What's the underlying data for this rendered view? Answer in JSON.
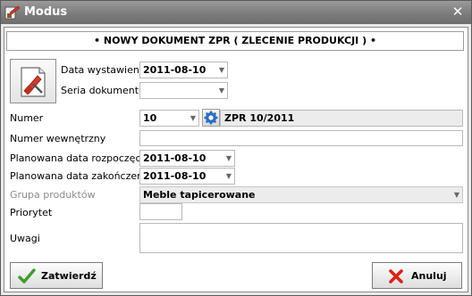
{
  "window": {
    "title": "Modus",
    "close_glyph": "✕"
  },
  "header": {
    "text": "• NOWY DOKUMENT ZPR ( ZLECENIE PRODUKCJI ) •"
  },
  "fields": {
    "data_wystawienia": {
      "label": "Data wystawienia",
      "value": "2011-08-10"
    },
    "seria_dokumentu": {
      "label": "Seria dokumentu",
      "value": ""
    },
    "numer": {
      "label": "Numer",
      "value": "10",
      "full_number": "ZPR 10/2011"
    },
    "numer_wewnetrzny": {
      "label": "Numer wewnętrzny",
      "value": ""
    },
    "planowana_data_rozpoczecia": {
      "label": "Planowana data rozpoczęcia",
      "value": "2011-08-10"
    },
    "planowana_data_zakonczenia": {
      "label": "Planowana data zakończenia",
      "value": "2011-08-10"
    },
    "grupa_produktow": {
      "label": "Grupa produktów",
      "value": "Meble tapicerowane"
    },
    "priorytet": {
      "label": "Priorytet",
      "value": ""
    },
    "uwagi": {
      "label": "Uwagi",
      "value": ""
    }
  },
  "buttons": {
    "confirm": "Zatwierdź",
    "cancel": "Anuluj"
  },
  "dropdown_glyph": "▼",
  "icons": {
    "app": "modus-app-icon",
    "document": "document-tools-icon",
    "number_settings": "gear-icon",
    "confirm": "checkmark-icon",
    "cancel": "red-x-icon"
  },
  "colors": {
    "title_bar": "#7c7c7c",
    "window_bg": "#e9e9e9",
    "disabled_text": "#8c8c8c",
    "cancel_red": "#d8231a",
    "confirm_green": "#3e9c2e",
    "gear_blue": "#2b6fc2"
  }
}
